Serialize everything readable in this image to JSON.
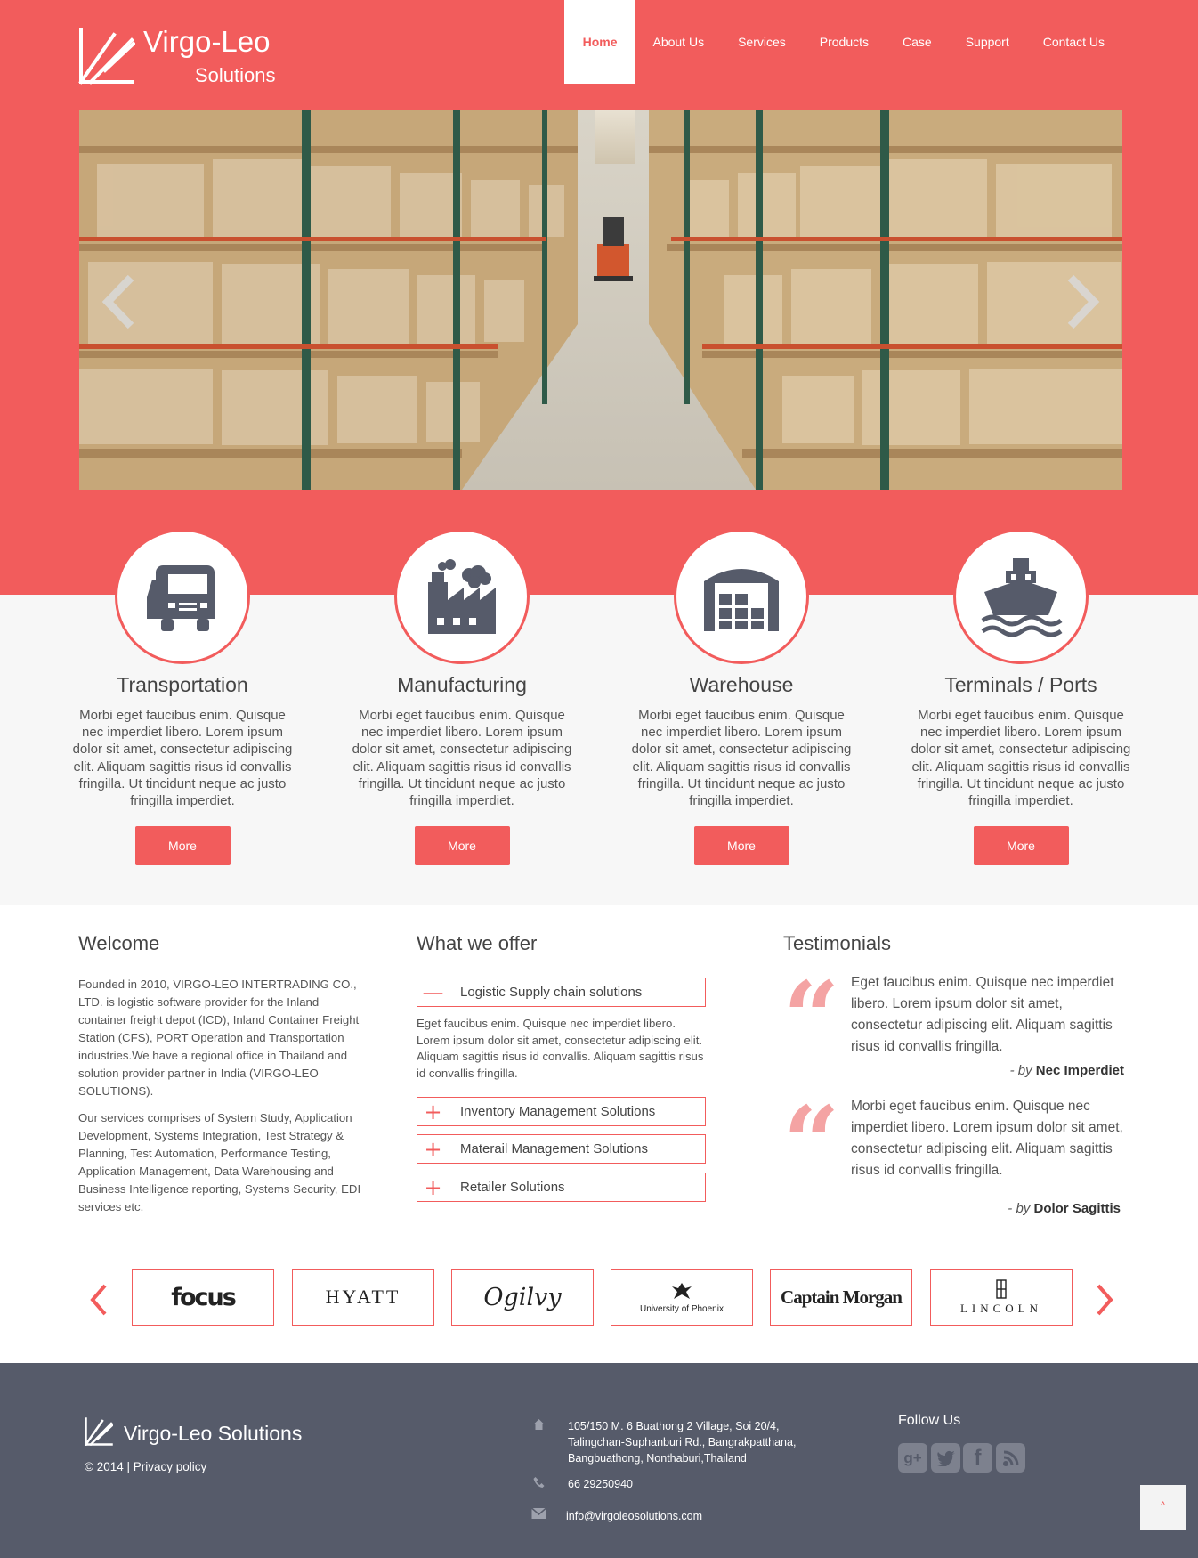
{
  "header": {
    "brand_line1": "Virgo-Leo",
    "brand_line2": "Solutions",
    "nav": [
      {
        "label": "Home",
        "active": true
      },
      {
        "label": "About Us"
      },
      {
        "label": "Services"
      },
      {
        "label": "Products"
      },
      {
        "label": "Case"
      },
      {
        "label": "Support"
      },
      {
        "label": "Contact Us"
      }
    ],
    "colors": {
      "accent": "#f25c5c",
      "footer": "#565b6a"
    }
  },
  "slider": {
    "image": "warehouse aisle with pallets and forklift",
    "prev_icon": "chevron-left-icon",
    "next_icon": "chevron-right-icon"
  },
  "features": [
    {
      "icon": "truck-icon",
      "title": "Transportation",
      "text": "Morbi eget faucibus enim. Quisque nec imperdiet libero. Lorem ipsum dolor sit amet, consectetur adipiscing elit. Aliquam sagittis risus id convallis fringilla. Ut tincidunt neque ac justo fringilla imperdiet.",
      "button": "More"
    },
    {
      "icon": "factory-icon",
      "title": "Manufacturing",
      "text": "Morbi eget faucibus enim. Quisque nec imperdiet libero. Lorem ipsum dolor sit amet, consectetur adipiscing elit. Aliquam sagittis risus id convallis fringilla. Ut tincidunt neque ac justo fringilla imperdiet.",
      "button": "More"
    },
    {
      "icon": "warehouse-icon",
      "title": "Warehouse",
      "text": "Morbi eget faucibus enim. Quisque nec imperdiet libero. Lorem ipsum dolor sit amet, consectetur adipiscing elit. Aliquam sagittis risus id convallis fringilla. Ut tincidunt neque ac justo fringilla imperdiet.",
      "button": "More"
    },
    {
      "icon": "ship-icon",
      "title": "Terminals / Ports",
      "text": "Morbi eget faucibus enim. Quisque nec imperdiet libero. Lorem ipsum dolor sit amet, consectetur adipiscing elit. Aliquam sagittis risus id convallis fringilla. Ut tincidunt neque ac justo fringilla imperdiet.",
      "button": "More"
    }
  ],
  "welcome": {
    "title": "Welcome",
    "p1": "Founded in 2010, VIRGO-LEO INTERTRADING CO., LTD. is logistic software provider for the Inland container freight depot (ICD), Inland Container Freight Station (CFS), PORT Operation and Transportation industries.We have a regional office in Thailand and solution provider partner in India (VIRGO-LEO SOLUTIONS).",
    "p2": "Our services comprises of System Study, Application Development, Systems Integration, Test Strategy & Planning, Test Automation, Performance Testing, Application Management, Data Warehousing and Business Intelligence reporting, Systems Security, EDI services etc."
  },
  "offer": {
    "title": "What we offer",
    "items": [
      {
        "label": "Logistic Supply chain solutions",
        "icon": "—"
      },
      {
        "label": "Inventory Management Solutions",
        "icon": "+"
      },
      {
        "label": "Materail Management Solutions",
        "icon": "+"
      },
      {
        "label": "Retailer Solutions",
        "icon": "+"
      }
    ],
    "open_body": "Eget faucibus enim. Quisque nec imperdiet libero. Lorem ipsum dolor sit amet, consectetur adipiscing elit. Aliquam sagittis risus id convallis. Aliquam sagittis risus id convallis fringilla."
  },
  "testimonials": {
    "title": "Testimonials",
    "quote_glyph": "“",
    "by_prefix": "- by",
    "items": [
      {
        "text": "Eget faucibus enim. Quisque nec imperdiet libero. Lorem ipsum dolor sit amet, consectetur adipiscing elit. Aliquam sagittis risus id convallis fringilla.",
        "author": "Nec Imperdiet"
      },
      {
        "text": "Morbi eget faucibus enim. Quisque nec imperdiet libero. Lorem ipsum dolor sit amet, consectetur adipiscing elit. Aliquam sagittis risus id convallis fringilla.",
        "author": "Dolor Sagittis"
      }
    ]
  },
  "clients": {
    "logos": [
      "focus",
      "HYATT",
      "Ogilvy",
      "University of Phoenix",
      "Captain Morgan",
      "LINCOLN"
    ],
    "prev_icon": "chevron-left-icon",
    "next_icon": "chevron-right-icon"
  },
  "footer": {
    "brand": "Virgo-Leo Solutions",
    "copyright": "© 2014 |",
    "privacy": "Privacy policy",
    "address": "105/150 M. 6 Buathong 2 Village, Soi 20/4, Talingchan-Suphanburi Rd., Bangrakpatthana, Bangbuathong, Nonthaburi,Thailand",
    "phone": "66 29250940",
    "email": "info@virgoleosolutions.com",
    "follow": "Follow Us",
    "social": [
      "google-plus-icon",
      "twitter-icon",
      "facebook-icon",
      "rss-icon"
    ],
    "to_top_glyph": "˄"
  }
}
